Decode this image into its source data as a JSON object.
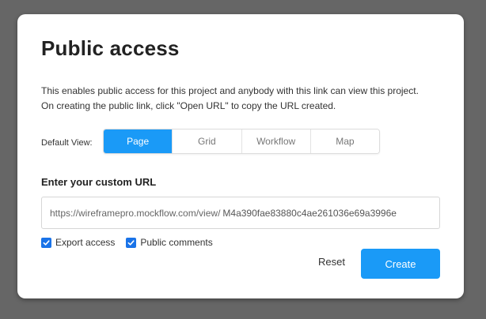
{
  "dialog": {
    "title": "Public access",
    "description_line1": "This enables public access for this project and anybody with this link can view this project.",
    "description_line2": "On creating the public link, click \"Open URL\" to copy the URL created."
  },
  "default_view": {
    "label": "Default View:",
    "options": [
      {
        "label": "Page",
        "selected": true
      },
      {
        "label": "Grid",
        "selected": false
      },
      {
        "label": "Workflow",
        "selected": false
      },
      {
        "label": "Map",
        "selected": false
      }
    ]
  },
  "custom_url": {
    "label": "Enter your custom URL",
    "prefix": "https://wireframepro.mockflow.com/view/",
    "value": "M4a390fae83880c4ae261036e69a3996e"
  },
  "options": {
    "export_access": {
      "label": "Export access",
      "checked": true
    },
    "public_comments": {
      "label": "Public comments",
      "checked": true
    }
  },
  "actions": {
    "reset_label": "Reset",
    "create_label": "Create"
  },
  "colors": {
    "accent": "#1a9af7",
    "checkbox": "#1a73e8",
    "overlay": "#666666"
  }
}
